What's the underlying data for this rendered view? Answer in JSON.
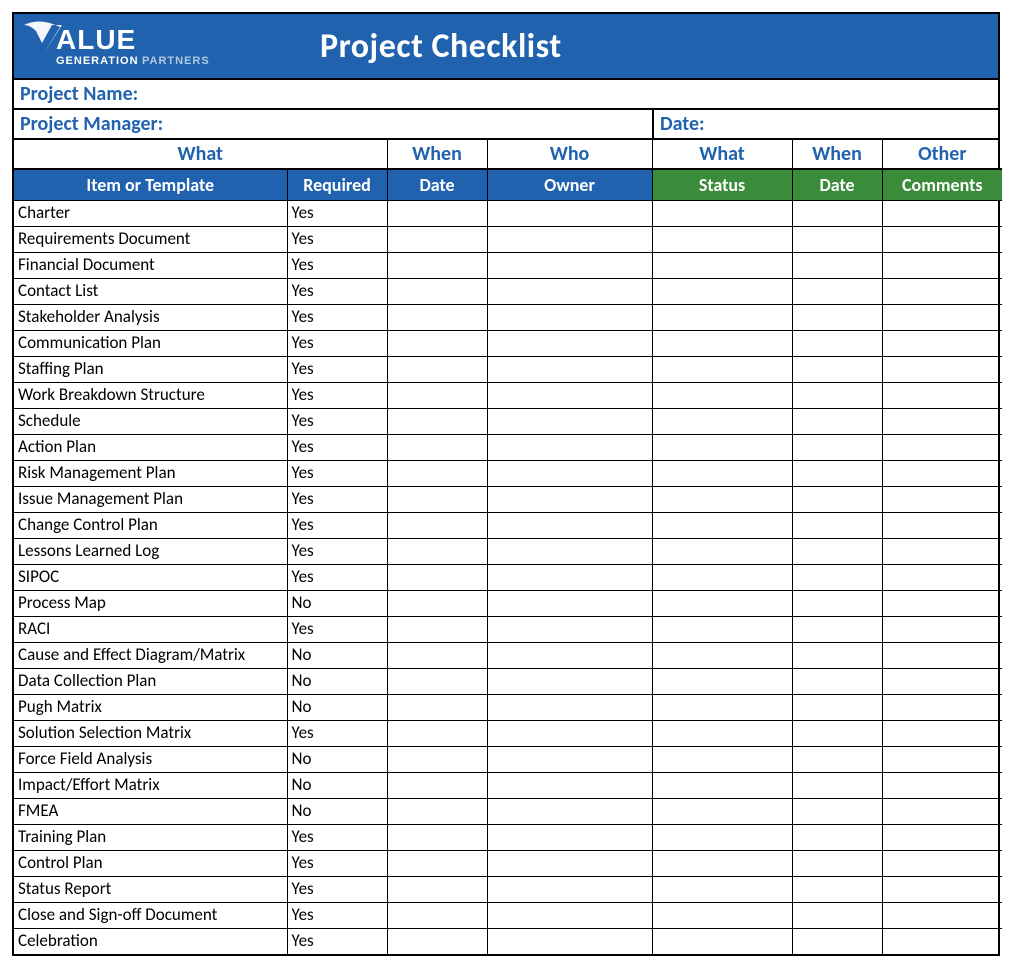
{
  "brand": {
    "big": "ALUE",
    "line2a": "GENERATION",
    "line2b": "PARTNERS"
  },
  "title": "Project Checklist",
  "meta": {
    "project_name_label": "Project Name:",
    "project_manager_label": "Project Manager:",
    "date_label": "Date:"
  },
  "groups": {
    "what1": "What",
    "when1": "When",
    "who": "Who",
    "what2": "What",
    "when2": "When",
    "other": "Other"
  },
  "columns": {
    "item": "Item or Template",
    "required": "Required",
    "date1": "Date",
    "owner": "Owner",
    "status": "Status",
    "date2": "Date",
    "comments": "Comments"
  },
  "rows": [
    {
      "item": "Charter",
      "required": "Yes",
      "date1": "",
      "owner": "",
      "status": "",
      "date2": "",
      "comments": ""
    },
    {
      "item": "Requirements Document",
      "required": "Yes",
      "date1": "",
      "owner": "",
      "status": "",
      "date2": "",
      "comments": ""
    },
    {
      "item": "Financial Document",
      "required": "Yes",
      "date1": "",
      "owner": "",
      "status": "",
      "date2": "",
      "comments": ""
    },
    {
      "item": "Contact List",
      "required": "Yes",
      "date1": "",
      "owner": "",
      "status": "",
      "date2": "",
      "comments": ""
    },
    {
      "item": "Stakeholder Analysis",
      "required": "Yes",
      "date1": "",
      "owner": "",
      "status": "",
      "date2": "",
      "comments": ""
    },
    {
      "item": "Communication Plan",
      "required": "Yes",
      "date1": "",
      "owner": "",
      "status": "",
      "date2": "",
      "comments": ""
    },
    {
      "item": "Staffing Plan",
      "required": "Yes",
      "date1": "",
      "owner": "",
      "status": "",
      "date2": "",
      "comments": ""
    },
    {
      "item": "Work Breakdown Structure",
      "required": "Yes",
      "date1": "",
      "owner": "",
      "status": "",
      "date2": "",
      "comments": ""
    },
    {
      "item": "Schedule",
      "required": "Yes",
      "date1": "",
      "owner": "",
      "status": "",
      "date2": "",
      "comments": ""
    },
    {
      "item": "Action Plan",
      "required": "Yes",
      "date1": "",
      "owner": "",
      "status": "",
      "date2": "",
      "comments": ""
    },
    {
      "item": "Risk Management Plan",
      "required": "Yes",
      "date1": "",
      "owner": "",
      "status": "",
      "date2": "",
      "comments": ""
    },
    {
      "item": "Issue Management Plan",
      "required": "Yes",
      "date1": "",
      "owner": "",
      "status": "",
      "date2": "",
      "comments": ""
    },
    {
      "item": "Change Control Plan",
      "required": "Yes",
      "date1": "",
      "owner": "",
      "status": "",
      "date2": "",
      "comments": ""
    },
    {
      "item": "Lessons Learned Log",
      "required": "Yes",
      "date1": "",
      "owner": "",
      "status": "",
      "date2": "",
      "comments": ""
    },
    {
      "item": "SIPOC",
      "required": "Yes",
      "date1": "",
      "owner": "",
      "status": "",
      "date2": "",
      "comments": ""
    },
    {
      "item": "Process Map",
      "required": "No",
      "date1": "",
      "owner": "",
      "status": "",
      "date2": "",
      "comments": ""
    },
    {
      "item": "RACI",
      "required": "Yes",
      "date1": "",
      "owner": "",
      "status": "",
      "date2": "",
      "comments": ""
    },
    {
      "item": "Cause and Effect Diagram/Matrix",
      "required": "No",
      "date1": "",
      "owner": "",
      "status": "",
      "date2": "",
      "comments": ""
    },
    {
      "item": "Data Collection Plan",
      "required": "No",
      "date1": "",
      "owner": "",
      "status": "",
      "date2": "",
      "comments": ""
    },
    {
      "item": "Pugh Matrix",
      "required": "No",
      "date1": "",
      "owner": "",
      "status": "",
      "date2": "",
      "comments": ""
    },
    {
      "item": "Solution Selection Matrix",
      "required": "Yes",
      "date1": "",
      "owner": "",
      "status": "",
      "date2": "",
      "comments": ""
    },
    {
      "item": "Force Field Analysis",
      "required": "No",
      "date1": "",
      "owner": "",
      "status": "",
      "date2": "",
      "comments": ""
    },
    {
      "item": "Impact/Effort Matrix",
      "required": "No",
      "date1": "",
      "owner": "",
      "status": "",
      "date2": "",
      "comments": ""
    },
    {
      "item": "FMEA",
      "required": "No",
      "date1": "",
      "owner": "",
      "status": "",
      "date2": "",
      "comments": ""
    },
    {
      "item": "Training Plan",
      "required": "Yes",
      "date1": "",
      "owner": "",
      "status": "",
      "date2": "",
      "comments": ""
    },
    {
      "item": "Control Plan",
      "required": "Yes",
      "date1": "",
      "owner": "",
      "status": "",
      "date2": "",
      "comments": ""
    },
    {
      "item": "Status Report",
      "required": "Yes",
      "date1": "",
      "owner": "",
      "status": "",
      "date2": "",
      "comments": ""
    },
    {
      "item": "Close and Sign-off Document",
      "required": "Yes",
      "date1": "",
      "owner": "",
      "status": "",
      "date2": "",
      "comments": ""
    },
    {
      "item": "Celebration",
      "required": "Yes",
      "date1": "",
      "owner": "",
      "status": "",
      "date2": "",
      "comments": ""
    }
  ]
}
